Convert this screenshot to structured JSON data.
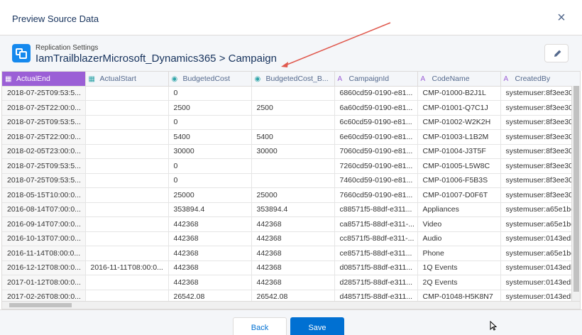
{
  "modal": {
    "title": "Preview Source Data",
    "close_label": "×"
  },
  "subheader": {
    "label": "Replication Settings",
    "title": "IamTrailblazerMicrosoft_Dynamics365 > Campaign"
  },
  "columns": [
    {
      "label": "ActualEnd",
      "icon": "calendar-icon",
      "glyph": "▦"
    },
    {
      "label": "ActualStart",
      "icon": "calendar-icon",
      "glyph": "▦"
    },
    {
      "label": "BudgetedCost",
      "icon": "currency-icon",
      "glyph": "◉"
    },
    {
      "label": "BudgetedCost_B...",
      "icon": "currency-icon",
      "glyph": "◉"
    },
    {
      "label": "CampaignId",
      "icon": "text-icon",
      "glyph": "A"
    },
    {
      "label": "CodeName",
      "icon": "text-icon",
      "glyph": "A"
    },
    {
      "label": "CreatedBy",
      "icon": "text-icon",
      "glyph": "A"
    }
  ],
  "rows": [
    [
      "2018-07-25T09:53:5...",
      "",
      "0",
      "",
      "6860cd59-0190-e81...",
      "CMP-01000-B2J1L",
      "systemuser:8f3ee30..."
    ],
    [
      "2018-07-25T22:00:0...",
      "",
      "2500",
      "2500",
      "6a60cd59-0190-e81...",
      "CMP-01001-Q7C1J",
      "systemuser:8f3ee30..."
    ],
    [
      "2018-07-25T09:53:5...",
      "",
      "0",
      "",
      "6c60cd59-0190-e81...",
      "CMP-01002-W2K2H",
      "systemuser:8f3ee30..."
    ],
    [
      "2018-07-25T22:00:0...",
      "",
      "5400",
      "5400",
      "6e60cd59-0190-e81...",
      "CMP-01003-L1B2M",
      "systemuser:8f3ee30..."
    ],
    [
      "2018-02-05T23:00:0...",
      "",
      "30000",
      "30000",
      "7060cd59-0190-e81...",
      "CMP-01004-J3T5F",
      "systemuser:8f3ee30..."
    ],
    [
      "2018-07-25T09:53:5...",
      "",
      "0",
      "",
      "7260cd59-0190-e81...",
      "CMP-01005-L5W8C",
      "systemuser:8f3ee30..."
    ],
    [
      "2018-07-25T09:53:5...",
      "",
      "0",
      "",
      "7460cd59-0190-e81...",
      "CMP-01006-F5B3S",
      "systemuser:8f3ee30..."
    ],
    [
      "2018-05-15T10:00:0...",
      "",
      "25000",
      "25000",
      "7660cd59-0190-e81...",
      "CMP-01007-D0F6T",
      "systemuser:8f3ee30..."
    ],
    [
      "2016-08-14T07:00:0...",
      "",
      "353894.4",
      "353894.4",
      "c88571f5-88df-e311...",
      "Appliances",
      "systemuser:a65e1be..."
    ],
    [
      "2016-09-14T07:00:0...",
      "",
      "442368",
      "442368",
      "ca8571f5-88df-e311-...",
      "Video",
      "systemuser:a65e1be..."
    ],
    [
      "2016-10-13T07:00:0...",
      "",
      "442368",
      "442368",
      "cc8571f5-88df-e311-...",
      "Audio",
      "systemuser:0143edb..."
    ],
    [
      "2016-11-14T08:00:0...",
      "",
      "442368",
      "442368",
      "ce8571f5-88df-e311...",
      "Phone",
      "systemuser:a65e1be..."
    ],
    [
      "2016-12-12T08:00:0...",
      "2016-11-11T08:00:0...",
      "442368",
      "442368",
      "d08571f5-88df-e311...",
      "1Q Events",
      "systemuser:0143edb..."
    ],
    [
      "2017-01-12T08:00:0...",
      "",
      "442368",
      "442368",
      "d28571f5-88df-e311...",
      "2Q Events",
      "systemuser:0143edb..."
    ],
    [
      "2017-02-26T08:00:0...",
      "",
      "26542.08",
      "26542.08",
      "d48571f5-88df-e311...",
      "CMP-01048-H5K8N7",
      "systemuser:0143edb..."
    ]
  ],
  "footer": {
    "back_label": "Back",
    "save_label": "Save"
  },
  "colors": {
    "active_header": "#9b5fd6",
    "primary_button": "#0070d2",
    "annotation_arrow": "#e05a4f"
  }
}
